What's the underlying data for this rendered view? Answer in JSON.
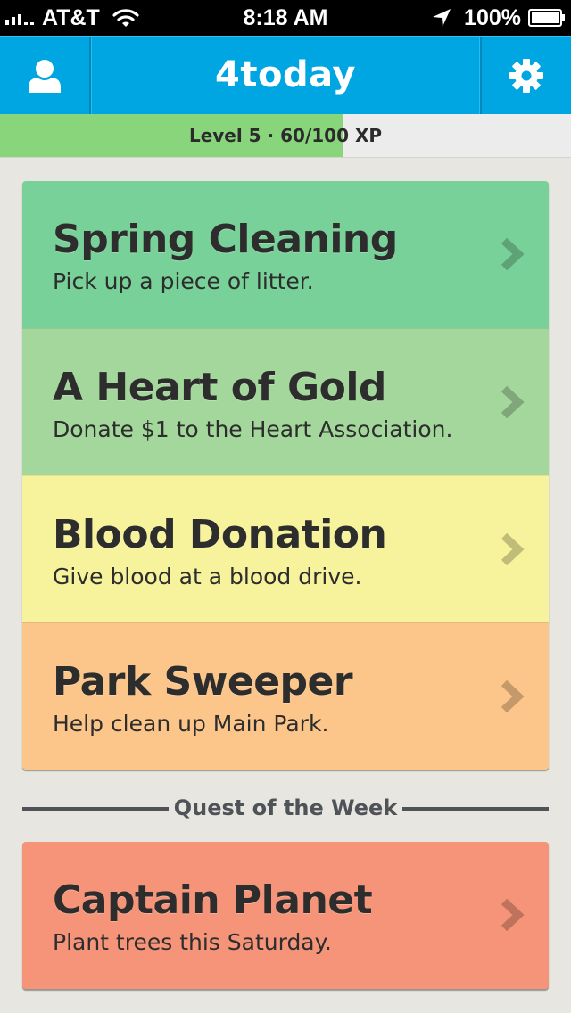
{
  "status_bar": {
    "carrier": "AT&T",
    "time": "8:18 AM",
    "battery": "100%"
  },
  "nav": {
    "title": "4today",
    "profile_icon": "user-icon",
    "settings_icon": "gear-icon"
  },
  "xp": {
    "label": "Level 5 · 60/100 XP",
    "progress": 0.6,
    "fill_color": "#89d57c"
  },
  "quests": [
    {
      "title": "Spring Cleaning",
      "description": "Pick up a piece of litter.",
      "color": "#78d198"
    },
    {
      "title": "A Heart of Gold",
      "description": "Donate $1 to the Heart Association.",
      "color": "#a3d79b"
    },
    {
      "title": "Blood Donation",
      "description": "Give blood at a blood drive.",
      "color": "#f7f39c"
    },
    {
      "title": "Park Sweeper",
      "description": "Help clean up Main Park.",
      "color": "#fcc68a"
    }
  ],
  "weekly": {
    "section_label": "Quest of the Week",
    "title": "Captain Planet",
    "description": "Plant trees this Saturday.",
    "color": "#f59478"
  },
  "colors": {
    "nav_blue": "#00a6e2",
    "background": "#e7e6e0",
    "text_dark": "#2d2d2d"
  }
}
